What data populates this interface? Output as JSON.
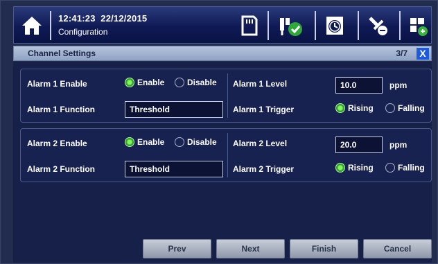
{
  "header": {
    "time": "12:41:23",
    "date": "22/12/2015",
    "screen": "Configuration",
    "icons": [
      "home-icon",
      "sd-card-icon",
      "plug-check-icon",
      "alarm-clock-icon",
      "tools-icon",
      "grid-settings-icon"
    ]
  },
  "titlebar": {
    "title": "Channel Settings",
    "page": "3/7",
    "close_label": "X"
  },
  "alarm1": {
    "enable_label": "Alarm 1 Enable",
    "enable_option": "Enable",
    "disable_option": "Disable",
    "enabled": true,
    "function_label": "Alarm 1 Function",
    "function_value": "Threshold",
    "level_label": "Alarm 1 Level",
    "level_value": "10.0",
    "unit": "ppm",
    "trigger_label": "Alarm 1 Trigger",
    "rising_option": "Rising",
    "falling_option": "Falling",
    "trigger": "Rising"
  },
  "alarm2": {
    "enable_label": "Alarm 2 Enable",
    "enable_option": "Enable",
    "disable_option": "Disable",
    "enabled": true,
    "function_label": "Alarm 2 Function",
    "function_value": "Threshold",
    "level_label": "Alarm 2 Level",
    "level_value": "20.0",
    "unit": "ppm",
    "trigger_label": "Alarm 2 Trigger",
    "rising_option": "Rising",
    "falling_option": "Falling",
    "trigger": "Rising"
  },
  "buttons": {
    "prev": "Prev",
    "next": "Next",
    "finish": "Finish",
    "cancel": "Cancel"
  },
  "colors": {
    "background": "#162048",
    "header": "#0f1a55",
    "accent": "#1e5ae0",
    "radio_on": "#37b53a"
  }
}
